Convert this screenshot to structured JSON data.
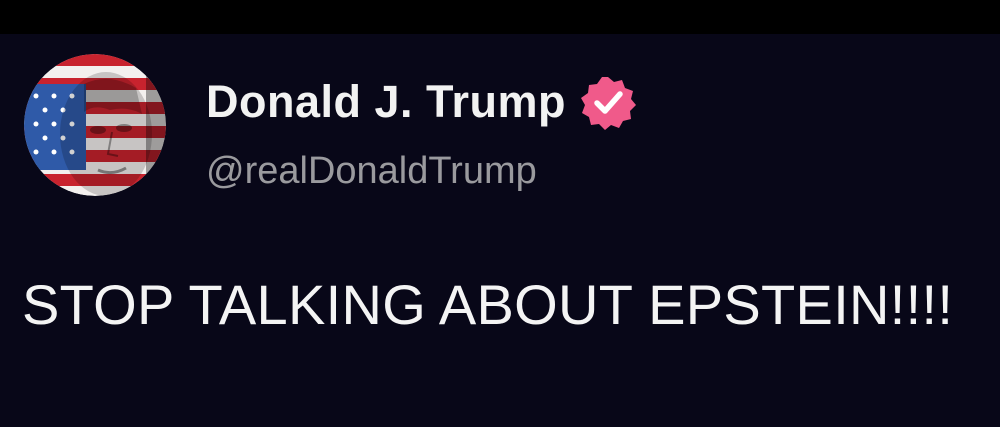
{
  "author": {
    "display_name": "Donald J. Trump",
    "handle": "@realDonaldTrump",
    "verified": true,
    "verified_badge_color": "#f05a8a"
  },
  "post": {
    "text": "STOP TALKING ABOUT EPSTEIN!!!!"
  },
  "colors": {
    "background": "#080718",
    "name": "#f2f2f2",
    "handle": "#9a9a9e",
    "body_text": "#f4f4f4"
  },
  "icons": {
    "avatar": "flag-portrait-avatar",
    "badge": "verified-badge-icon"
  }
}
